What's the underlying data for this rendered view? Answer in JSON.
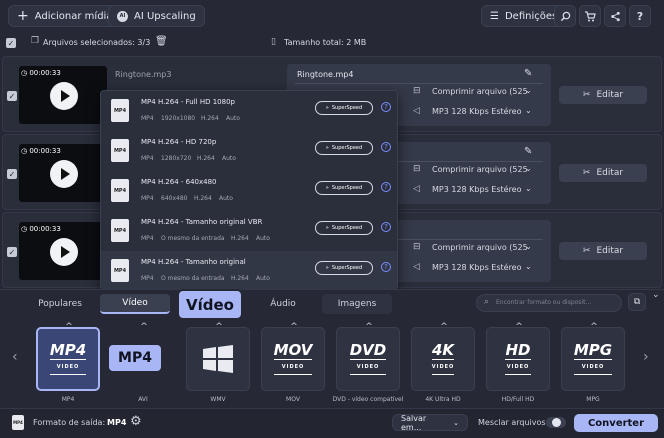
{
  "toolbar": {
    "add_media": "Adicionar mídia",
    "ai_upscaling": "AI Upscaling",
    "settings": "Definições",
    "icons": [
      "search-icon",
      "cart-icon",
      "share-icon",
      "help-icon"
    ]
  },
  "selection": {
    "selected_label": "Arquivos selecionados: 3/3",
    "total_size": "Tamanho total: 2 MB"
  },
  "files": [
    {
      "time": "00:00:33",
      "name": "Ringtone.mp3",
      "output_name": "Ringtone.mp4",
      "compress": "Comprimir arquivo (525",
      "audio": "MP3 128 Kbps Estéreo",
      "edit": "Editar"
    },
    {
      "time": "00:00:33",
      "name": "",
      "output_name": "",
      "compress": "Comprimir arquivo (525",
      "audio": "MP3 128 Kbps Estéreo",
      "edit": "Editar"
    },
    {
      "time": "00:00:33",
      "name": "",
      "output_name": "",
      "compress": "Comprimir arquivo (525",
      "audio": "MP3 128 Kbps Estéreo",
      "edit": "Editar"
    }
  ],
  "presets": [
    {
      "title": "MP4 H.264 - Full HD 1080p",
      "c1": "MP4",
      "c2": "1920x1080",
      "c3": "H.264",
      "c4": "Auto"
    },
    {
      "title": "MP4 H.264 - HD 720p",
      "c1": "MP4",
      "c2": "1280x720",
      "c3": "H.264",
      "c4": "Auto"
    },
    {
      "title": "MP4 H.264 - 640x480",
      "c1": "MP4",
      "c2": "640x480",
      "c3": "H.264",
      "c4": "Auto"
    },
    {
      "title": "MP4 H.264 - Tamanho original VBR",
      "c1": "MP4",
      "c2": "O mesmo da entrada",
      "c3": "H.264",
      "c4": "Auto"
    },
    {
      "title": "MP4 H.264 - Tamanho original",
      "c1": "MP4",
      "c2": "O mesmo da entrada",
      "c3": "H.264",
      "c4": "Auto"
    }
  ],
  "superspeed_label": "SuperSpeed",
  "file_icon_label": "MP4",
  "tabs": [
    {
      "label": "Populares"
    },
    {
      "label": "Vídeo"
    },
    {
      "label": "Áudio"
    },
    {
      "label": "Imagens"
    }
  ],
  "search": {
    "placeholder": "Encontrar formato ou disposit..."
  },
  "callouts": {
    "video": "Vídeo",
    "mp4": "MP4"
  },
  "formats": [
    {
      "label": "MP4",
      "logo": "MP4",
      "sub": "VIDEO"
    },
    {
      "label": "AVI",
      "logo": "AVI",
      "sub": ""
    },
    {
      "label": "WMV",
      "logo": "",
      "sub": ""
    },
    {
      "label": "MOV",
      "logo": "MOV",
      "sub": "VIDEO"
    },
    {
      "label": "DVD - vídeo compatível",
      "logo": "DVD",
      "sub": "VIDEO"
    },
    {
      "label": "4K Ultra HD",
      "logo": "4K",
      "sub": "VIDEO"
    },
    {
      "label": "HD/Full HD",
      "logo": "HD",
      "sub": "VIDEO"
    },
    {
      "label": "MPG",
      "logo": "MPG",
      "sub": "VIDEO"
    }
  ],
  "footer": {
    "output_label": "Formato de saída:",
    "output_value": "MP4",
    "save_to": "Salvar em...",
    "merge_label": "Mesclar arquivos:",
    "convert": "Converter"
  },
  "colors": {
    "accent": "#a9b6f5",
    "bg": "#262935",
    "panel": "#353a4a"
  }
}
